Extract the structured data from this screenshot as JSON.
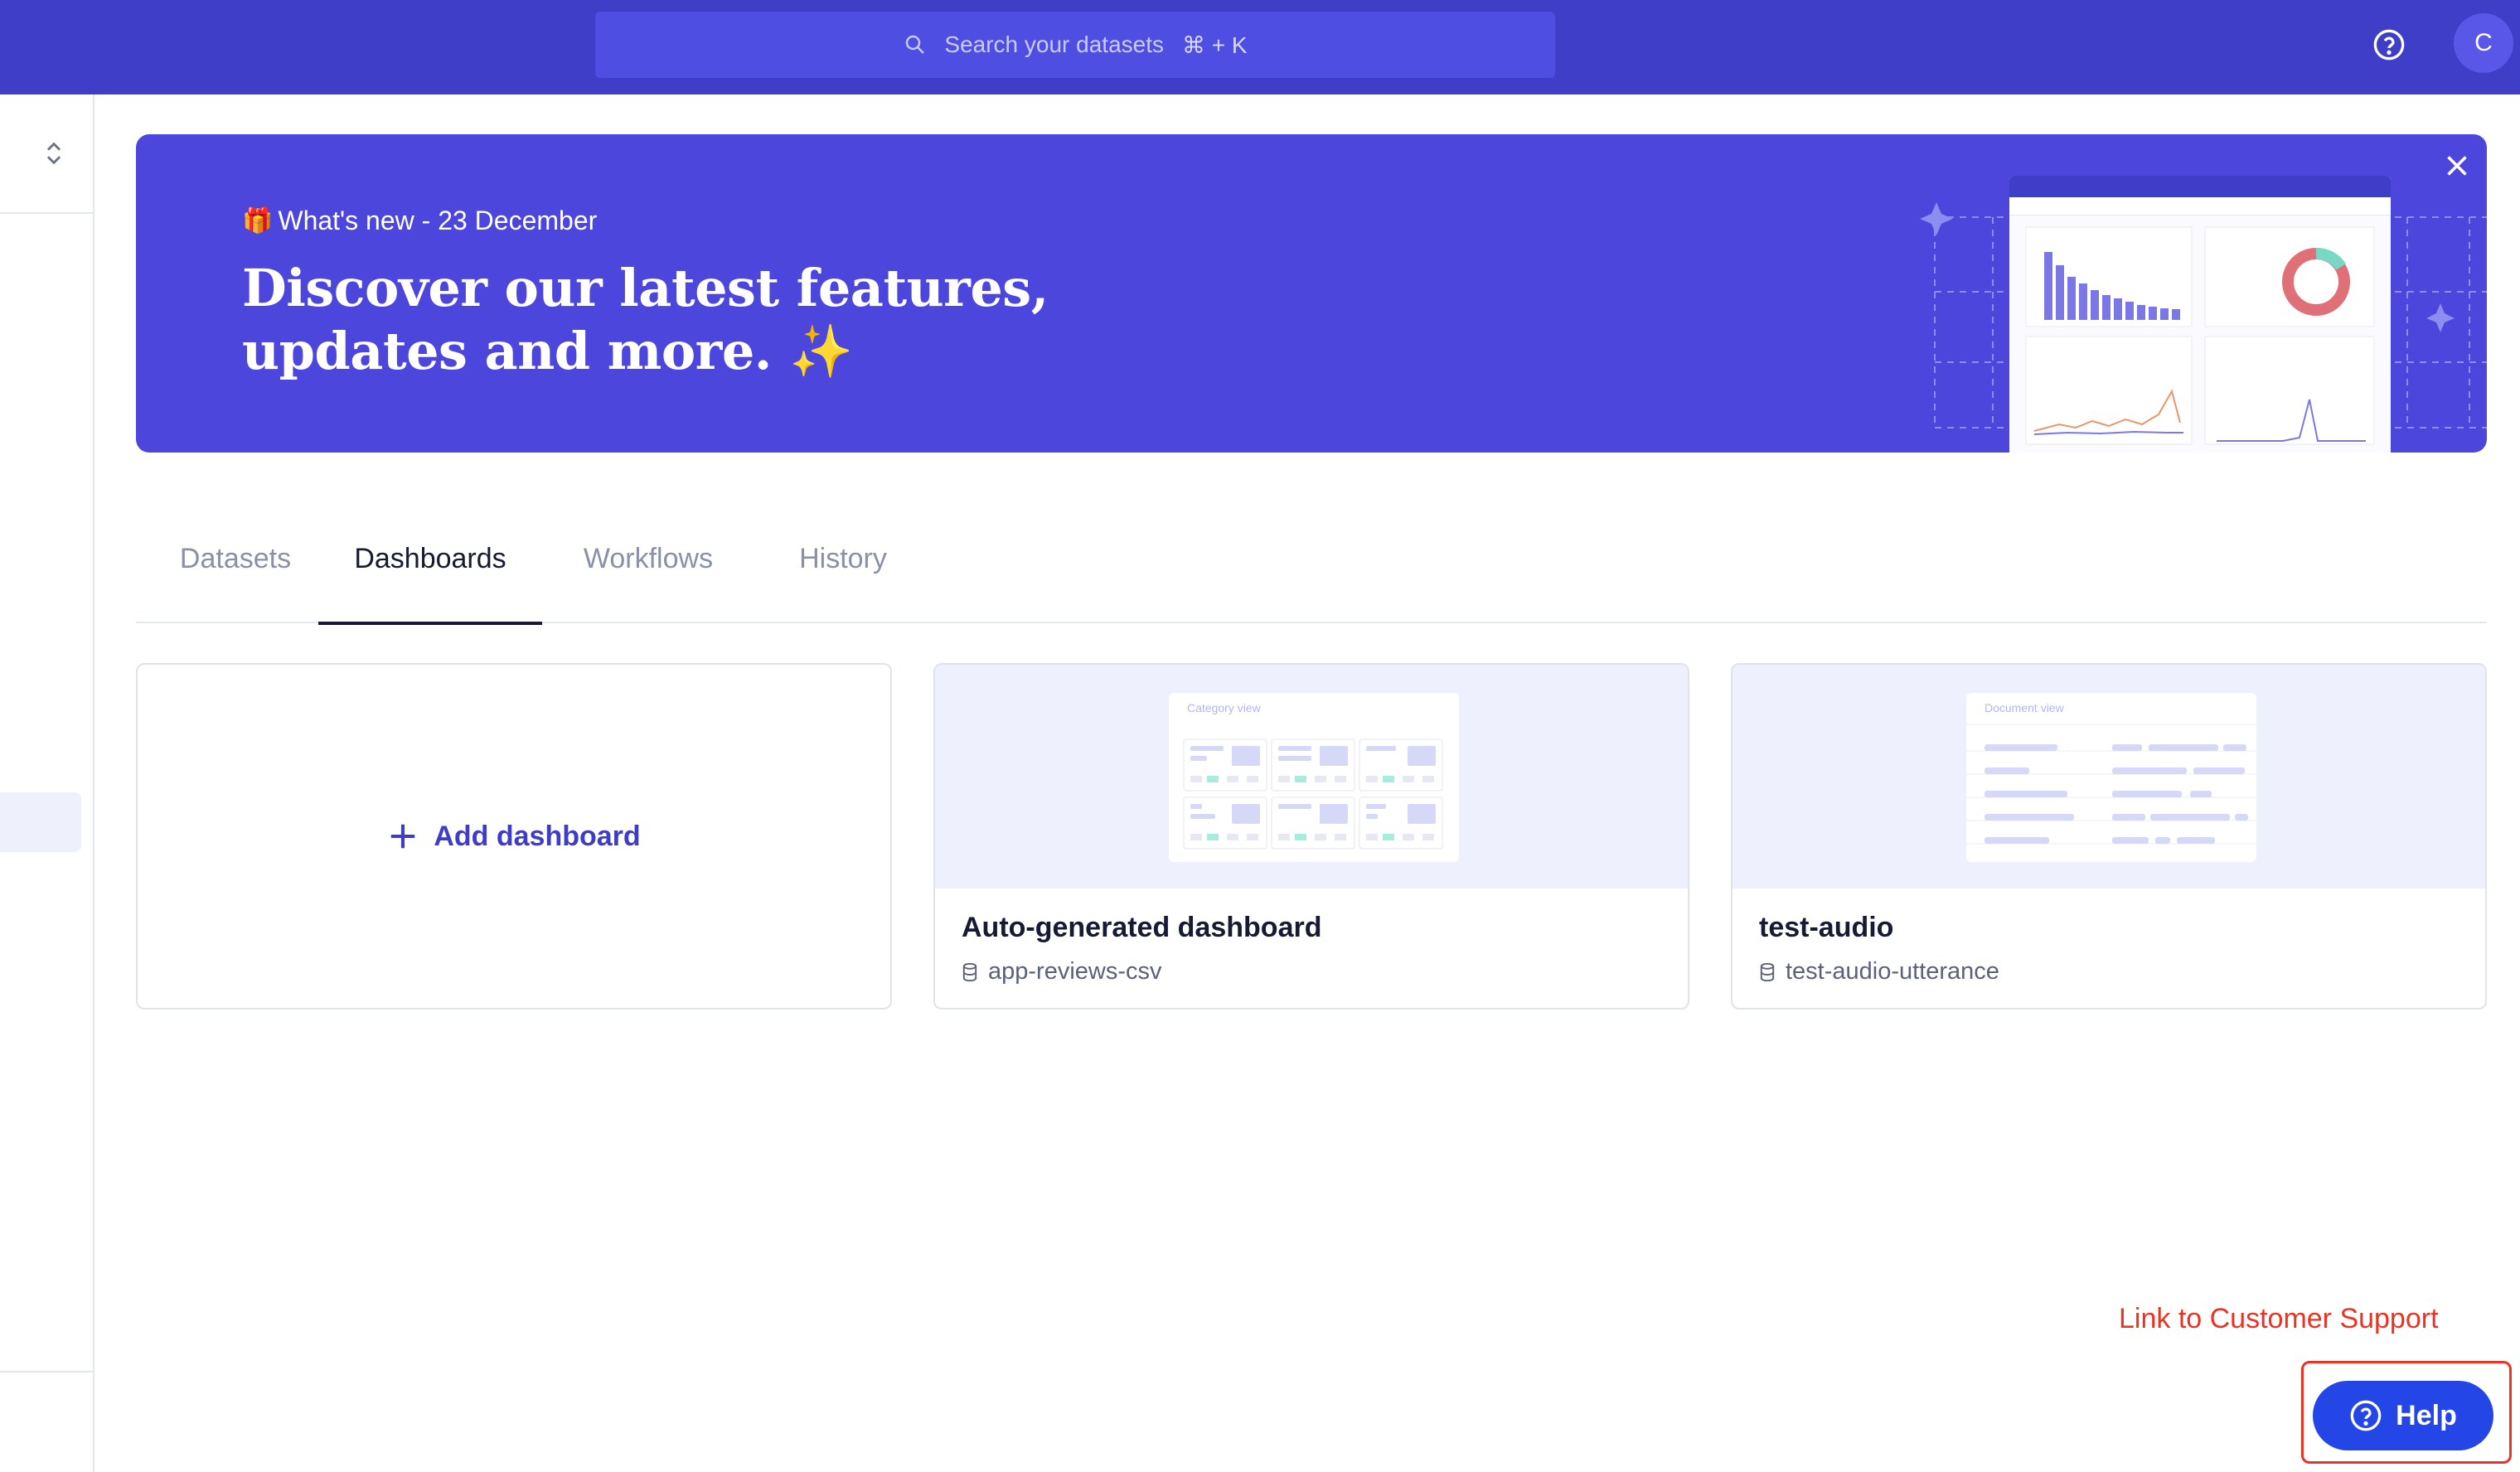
{
  "search": {
    "placeholder": "Search your datasets",
    "shortcut": "⌘ + K"
  },
  "user": {
    "avatar_initial": "C"
  },
  "banner": {
    "kicker": "What's new - 23 December",
    "headline_line1": "Discover our latest features,",
    "headline_line2": "updates and more. ✨"
  },
  "tabs": [
    {
      "label": "Datasets",
      "active": false
    },
    {
      "label": "Dashboards",
      "active": true
    },
    {
      "label": "Workflows",
      "active": false
    },
    {
      "label": "History",
      "active": false
    }
  ],
  "cards": {
    "add": {
      "label": "Add dashboard"
    },
    "items": [
      {
        "title": "Auto-generated dashboard",
        "dataset": "app-reviews-csv",
        "preview_label": "Category view"
      },
      {
        "title": "test-audio",
        "dataset": "test-audio-utterance",
        "preview_label": "Document view"
      }
    ]
  },
  "support": {
    "annotation": "Link to Customer Support",
    "help_label": "Help"
  },
  "colors": {
    "topbar": "#3e3ec8",
    "banner": "#4c46dc",
    "accent": "#3f3dc6",
    "help": "#2446e6",
    "annotation": "#ea3323"
  }
}
